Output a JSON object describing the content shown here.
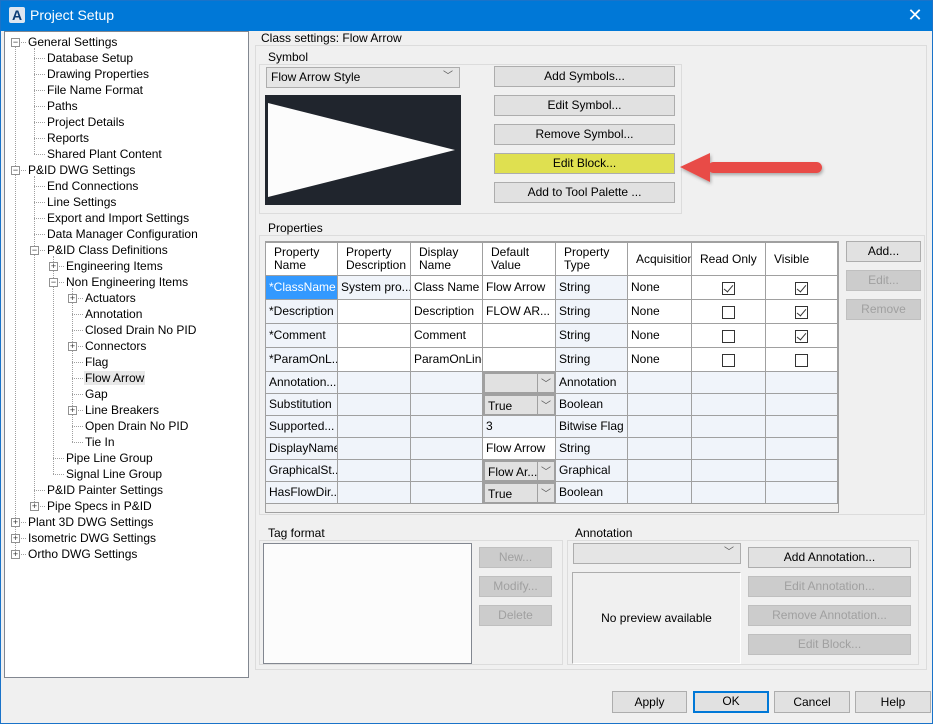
{
  "window": {
    "title": "Project Setup",
    "close_label": "✕"
  },
  "tree": {
    "items": [
      {
        "label": "General Settings",
        "level": 0,
        "expander": "minus"
      },
      {
        "label": "Database Setup",
        "level": 1,
        "expander": null
      },
      {
        "label": "Drawing Properties",
        "level": 1,
        "expander": null
      },
      {
        "label": "File Name Format",
        "level": 1,
        "expander": null
      },
      {
        "label": "Paths",
        "level": 1,
        "expander": null
      },
      {
        "label": "Project Details",
        "level": 1,
        "expander": null
      },
      {
        "label": "Reports",
        "level": 1,
        "expander": null
      },
      {
        "label": "Shared Plant Content",
        "level": 1,
        "expander": null
      },
      {
        "label": "P&ID DWG Settings",
        "level": 0,
        "expander": "minus"
      },
      {
        "label": "End Connections",
        "level": 1,
        "expander": null
      },
      {
        "label": "Line Settings",
        "level": 1,
        "expander": null
      },
      {
        "label": "Export and Import Settings",
        "level": 1,
        "expander": null
      },
      {
        "label": "Data Manager Configuration",
        "level": 1,
        "expander": null
      },
      {
        "label": "P&ID Class Definitions",
        "level": 1,
        "expander": "minus"
      },
      {
        "label": "Engineering Items",
        "level": 2,
        "expander": "plus"
      },
      {
        "label": "Non Engineering Items",
        "level": 2,
        "expander": "minus"
      },
      {
        "label": "Actuators",
        "level": 3,
        "expander": "plus"
      },
      {
        "label": "Annotation",
        "level": 3,
        "expander": null
      },
      {
        "label": "Closed Drain No PID",
        "level": 3,
        "expander": null
      },
      {
        "label": "Connectors",
        "level": 3,
        "expander": "plus"
      },
      {
        "label": "Flag",
        "level": 3,
        "expander": null
      },
      {
        "label": "Flow Arrow",
        "level": 3,
        "expander": null,
        "selected": true
      },
      {
        "label": "Gap",
        "level": 3,
        "expander": null
      },
      {
        "label": "Line Breakers",
        "level": 3,
        "expander": "plus"
      },
      {
        "label": "Open Drain No PID",
        "level": 3,
        "expander": null
      },
      {
        "label": "Tie In",
        "level": 3,
        "expander": null
      },
      {
        "label": "Pipe Line Group",
        "level": 2,
        "expander": null
      },
      {
        "label": "Signal Line Group",
        "level": 2,
        "expander": null
      },
      {
        "label": "P&ID Painter Settings",
        "level": 1,
        "expander": null
      },
      {
        "label": "Pipe Specs in P&ID",
        "level": 1,
        "expander": "plus"
      },
      {
        "label": "Plant 3D DWG Settings",
        "level": 0,
        "expander": "plus"
      },
      {
        "label": "Isometric DWG Settings",
        "level": 0,
        "expander": "plus"
      },
      {
        "label": "Ortho DWG Settings",
        "level": 0,
        "expander": "plus"
      }
    ]
  },
  "class_settings": {
    "label": "Class settings: Flow Arrow",
    "symbol": {
      "label": "Symbol",
      "style_value": "Flow Arrow Style",
      "preview_icon": "flow-arrow-triangle",
      "buttons": {
        "add_symbols": "Add Symbols...",
        "edit_symbol": "Edit Symbol...",
        "remove_symbol": "Remove Symbol...",
        "edit_block": "Edit Block...",
        "add_to_tool_palette": "Add to Tool Palette ..."
      },
      "highlight_color": "#dfe050",
      "annotation_arrow_color": "#e84c47"
    },
    "properties": {
      "label": "Properties",
      "columns": [
        "Property\nName",
        "Property\nDescription",
        "Display\nName",
        "Default\nValue",
        "Property\nType",
        "Acquisition",
        "Read Only",
        "Visible"
      ],
      "rows": [
        {
          "name": "*ClassName",
          "description": "System pro...",
          "display": "Class Name",
          "default": "Flow Arrow",
          "default_kind": "text",
          "type": "String",
          "acquisition": "None",
          "read_only": true,
          "visible": true,
          "selected": true
        },
        {
          "name": "*Description",
          "description": "",
          "display": "Description",
          "default": "FLOW AR...",
          "default_kind": "text",
          "type": "String",
          "acquisition": "None",
          "read_only": false,
          "visible": true
        },
        {
          "name": "*Comment",
          "description": "",
          "display": "Comment",
          "default": "",
          "default_kind": "text",
          "type": "String",
          "acquisition": "None",
          "read_only": false,
          "visible": true
        },
        {
          "name": "*ParamOnL...",
          "description": "",
          "display": "ParamOnLine",
          "default": "",
          "default_kind": "text",
          "type": "String",
          "acquisition": "None",
          "read_only": false,
          "visible": false
        },
        {
          "name": "Annotation...",
          "description": "",
          "display": "",
          "default": "",
          "default_kind": "combo",
          "type": "Annotation",
          "acquisition": "",
          "read_only": null,
          "visible": null
        },
        {
          "name": "Substitution",
          "description": "",
          "display": "",
          "default": "True",
          "default_kind": "combo",
          "type": "Boolean",
          "acquisition": "",
          "read_only": null,
          "visible": null
        },
        {
          "name": "Supported...",
          "description": "",
          "display": "",
          "default": "3",
          "default_kind": "readonly",
          "type": "Bitwise Flag",
          "acquisition": "",
          "read_only": null,
          "visible": null
        },
        {
          "name": "DisplayName",
          "description": "",
          "display": "",
          "default": "Flow Arrow",
          "default_kind": "text",
          "type": "String",
          "acquisition": "",
          "read_only": null,
          "visible": null
        },
        {
          "name": "GraphicalSt...",
          "description": "",
          "display": "",
          "default": "Flow Ar...",
          "default_kind": "combo",
          "type": "Graphical",
          "acquisition": "",
          "read_only": null,
          "visible": null
        },
        {
          "name": "HasFlowDir...",
          "description": "",
          "display": "",
          "default": "True",
          "default_kind": "combo",
          "type": "Boolean",
          "acquisition": "",
          "read_only": null,
          "visible": null
        }
      ],
      "buttons": {
        "add": "Add...",
        "edit": "Edit...",
        "remove": "Remove"
      }
    },
    "tag_format": {
      "label": "Tag format",
      "buttons": {
        "new": "New...",
        "modify": "Modify...",
        "delete": "Delete"
      }
    },
    "annotation": {
      "label": "Annotation",
      "selected_value": "",
      "preview_text": "No preview available",
      "buttons": {
        "add": "Add Annotation...",
        "edit": "Edit Annotation...",
        "remove": "Remove Annotation...",
        "edit_block": "Edit Block..."
      }
    }
  },
  "footer": {
    "apply": "Apply",
    "ok": "OK",
    "cancel": "Cancel",
    "help": "Help"
  }
}
